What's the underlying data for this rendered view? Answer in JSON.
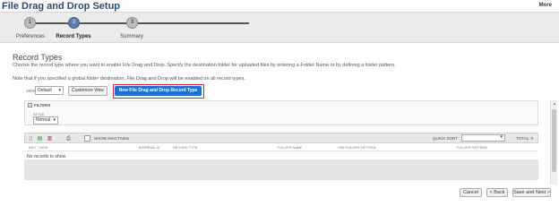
{
  "app": {
    "title": "File Drag and Drop Setup",
    "more": "More"
  },
  "wizard": {
    "steps": [
      {
        "number": "1",
        "label": "Preferences"
      },
      {
        "number": "2",
        "label": "Record Types"
      },
      {
        "number": "3",
        "label": "Summary"
      }
    ],
    "active_step": 2
  },
  "section": {
    "title": "Record Types",
    "description": "Choose the record type where you want to enable File Drag and Drop. Specify the destination folder for uploaded files by entering a Folder Name or by defining a folder pattern.",
    "note": "Note that if you specified a global folder destination, File Drag and Drop will be enabled on all record types."
  },
  "controls": {
    "view_label": "VIEW",
    "view_value": "Default",
    "customize_view": "Customize View",
    "new_record_type": "New File Drag and Drop Record Type"
  },
  "filters": {
    "title": "FILTERS",
    "style_label": "STYLE",
    "style_value": "Normal"
  },
  "list_toolbar": {
    "show_inactives": "SHOW INACTIVES",
    "quick_sort_label": "QUICK SORT",
    "total": "TOTAL: 0"
  },
  "table": {
    "columns": [
      "EDIT | VIEW",
      "INTERNAL ID",
      "RECORD TYPE",
      "FOLDER NAME",
      "USE FOLDER PATTERN",
      "FOLDER PATTERN"
    ],
    "empty_message": "No records to show."
  },
  "footer": {
    "cancel": "Cancel",
    "back": "< Back",
    "save_next": "Save and Next >"
  },
  "colors": {
    "accent_button": "#1b6fd6",
    "highlight_outline": "#d0202a",
    "active_step": "#5b7fa6"
  }
}
